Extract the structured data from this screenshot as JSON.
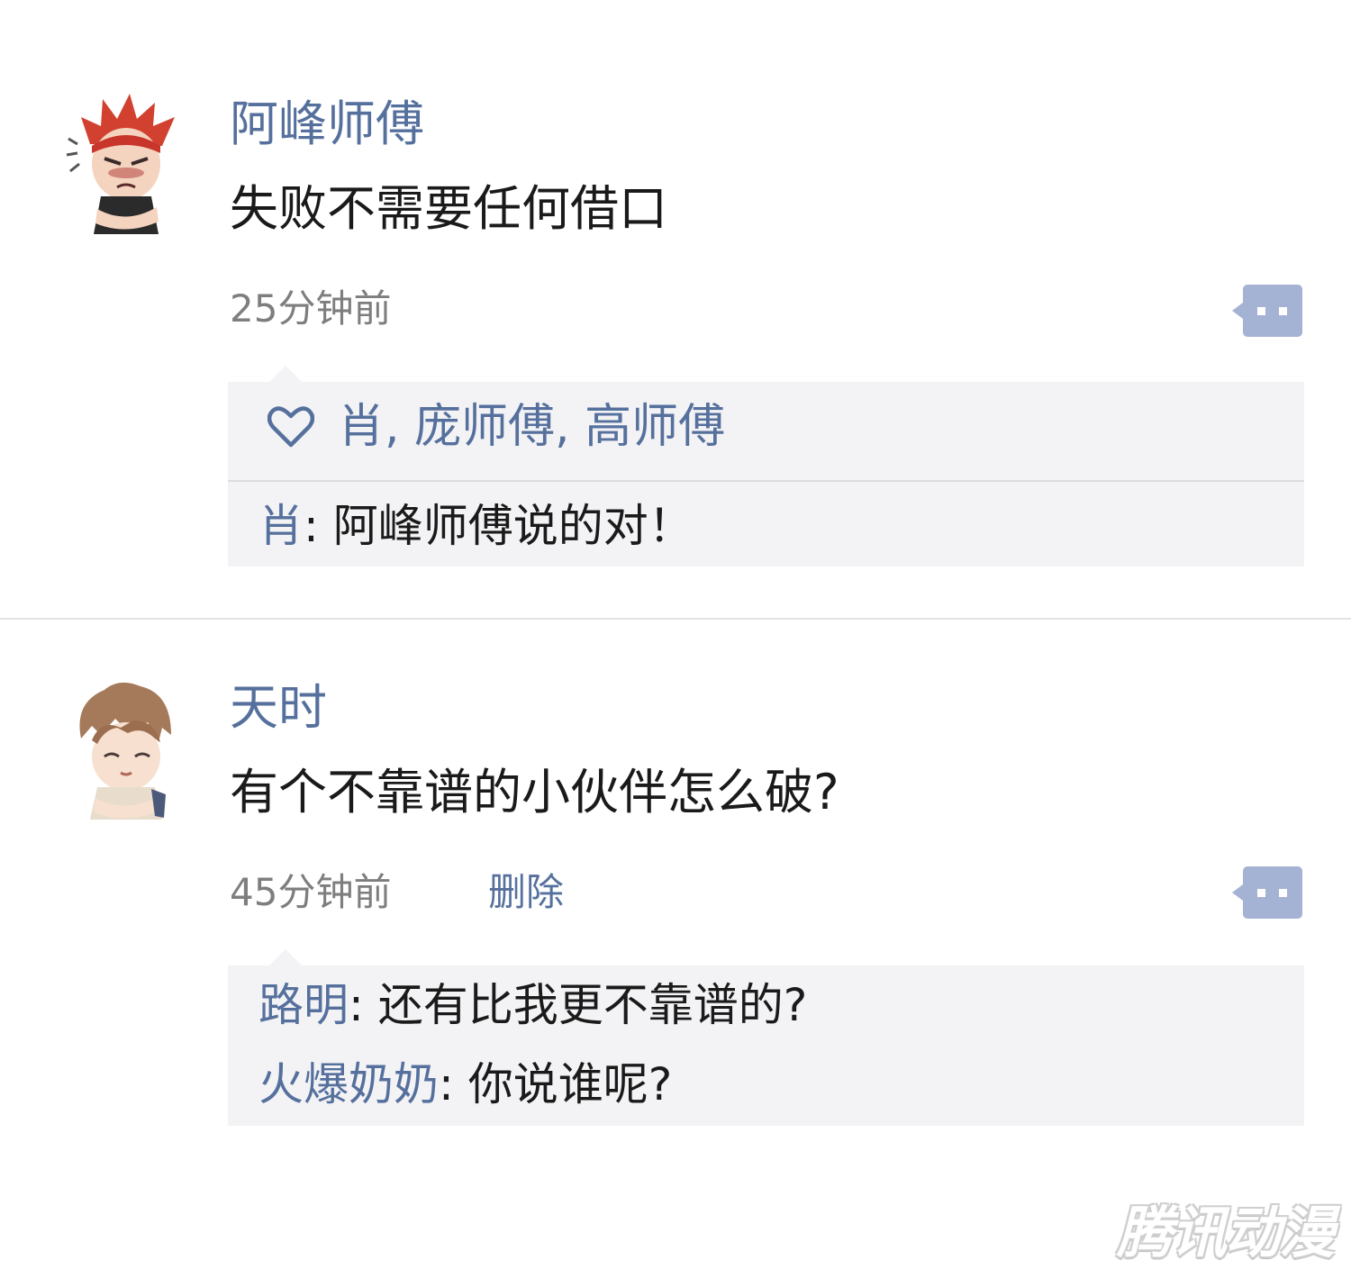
{
  "posts": [
    {
      "author": "阿峰师傅",
      "content": "失败不需要任何借口",
      "time": "25分钟前",
      "likes": "肖, 庞师傅, 高师傅",
      "replies": [
        {
          "name": "肖",
          "sep": ": ",
          "text": "阿峰师傅说的对！"
        }
      ]
    },
    {
      "author": "天时",
      "content": "有个不靠谱的小伙伴怎么破?",
      "time": "45分钟前",
      "delete_label": "删除",
      "replies": [
        {
          "name": "路明",
          "sep": ": ",
          "text": "还有比我更不靠谱的?"
        },
        {
          "name": "火爆奶奶",
          "sep": ": ",
          "text": "你说谁呢?"
        }
      ]
    }
  ],
  "watermark": "腾讯动漫",
  "icons": {
    "comment": "comment-bubble-icon",
    "like": "heart-icon"
  },
  "colors": {
    "link": "#56709d",
    "comment_button": "#a4b3d3",
    "panel_bg": "#f3f3f5",
    "time": "#7e7e7e"
  }
}
